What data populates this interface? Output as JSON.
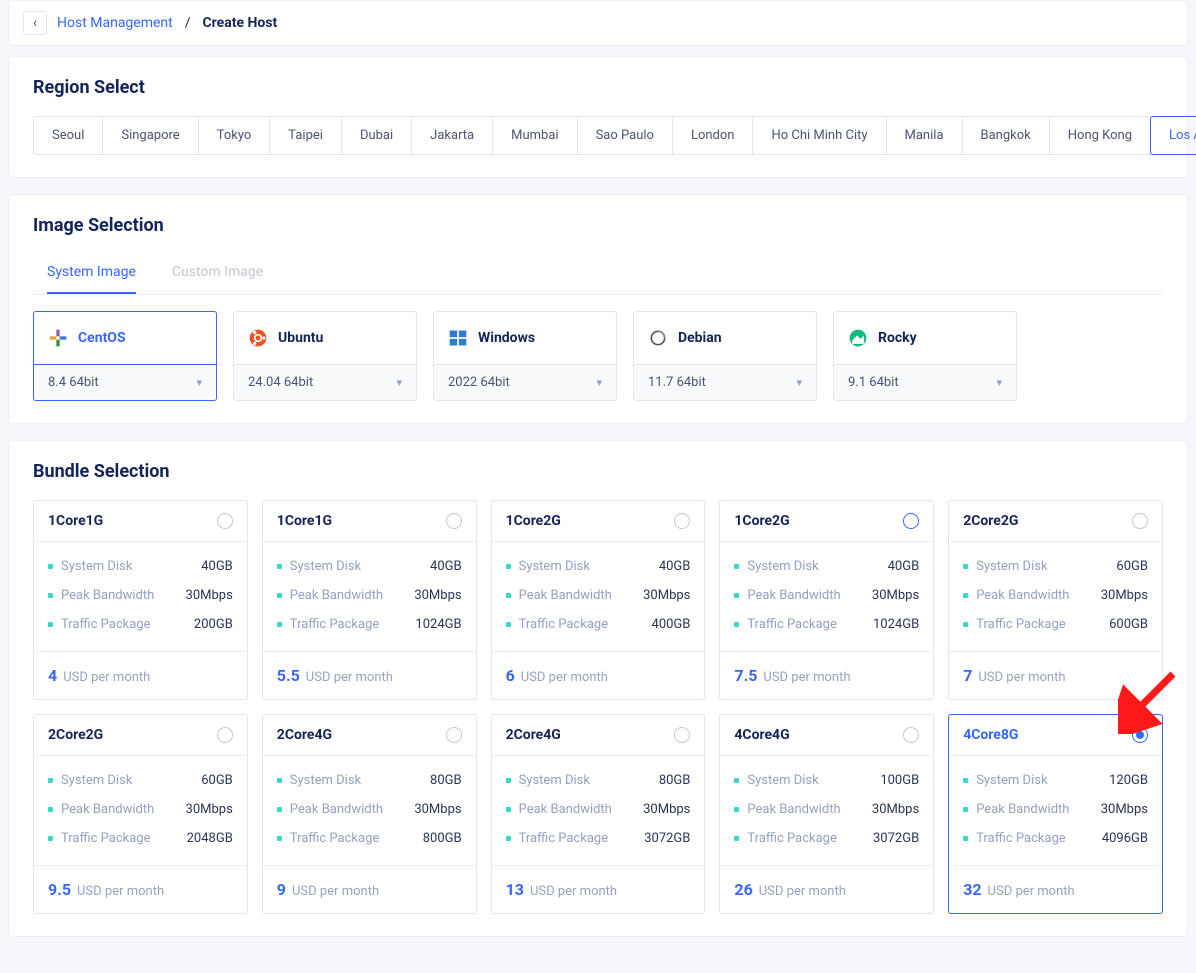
{
  "breadcrumb": {
    "back_icon": "‹",
    "link": "Host Management",
    "current": "Create Host"
  },
  "region": {
    "title": "Region Select",
    "items": [
      "Seoul",
      "Singapore",
      "Tokyo",
      "Taipei",
      "Dubai",
      "Jakarta",
      "Mumbai",
      "Sao Paulo",
      "London",
      "Ho Chi Minh City",
      "Manila",
      "Bangkok",
      "Hong Kong",
      "Los Angeles"
    ],
    "selected_index": 13
  },
  "image_section": {
    "title": "Image Selection",
    "tabs": [
      "System Image",
      "Custom Image"
    ],
    "active_tab": 0,
    "images": [
      {
        "name": "CentOS",
        "version": "8.4 64bit",
        "selected": true,
        "icon": "centos"
      },
      {
        "name": "Ubuntu",
        "version": "24.04 64bit",
        "selected": false,
        "icon": "ubuntu"
      },
      {
        "name": "Windows",
        "version": "2022 64bit",
        "selected": false,
        "icon": "windows"
      },
      {
        "name": "Debian",
        "version": "11.7 64bit",
        "selected": false,
        "icon": "debian"
      },
      {
        "name": "Rocky",
        "version": "9.1 64bit",
        "selected": false,
        "icon": "rocky"
      }
    ]
  },
  "bundle_section": {
    "title": "Bundle Selection",
    "spec_labels": {
      "disk": "System Disk",
      "bandwidth": "Peak Bandwidth",
      "traffic": "Traffic Package"
    },
    "price_suffix": "USD per month",
    "selected_index": 9,
    "ringed_index": 3,
    "bundles": [
      {
        "name": "1Core1G",
        "disk": "40GB",
        "bandwidth": "30Mbps",
        "traffic": "200GB",
        "price": "4"
      },
      {
        "name": "1Core1G",
        "disk": "40GB",
        "bandwidth": "30Mbps",
        "traffic": "1024GB",
        "price": "5.5"
      },
      {
        "name": "1Core2G",
        "disk": "40GB",
        "bandwidth": "30Mbps",
        "traffic": "400GB",
        "price": "6"
      },
      {
        "name": "1Core2G",
        "disk": "40GB",
        "bandwidth": "30Mbps",
        "traffic": "1024GB",
        "price": "7.5"
      },
      {
        "name": "2Core2G",
        "disk": "60GB",
        "bandwidth": "30Mbps",
        "traffic": "600GB",
        "price": "7"
      },
      {
        "name": "2Core2G",
        "disk": "60GB",
        "bandwidth": "30Mbps",
        "traffic": "2048GB",
        "price": "9.5"
      },
      {
        "name": "2Core4G",
        "disk": "80GB",
        "bandwidth": "30Mbps",
        "traffic": "800GB",
        "price": "9"
      },
      {
        "name": "2Core4G",
        "disk": "80GB",
        "bandwidth": "30Mbps",
        "traffic": "3072GB",
        "price": "13"
      },
      {
        "name": "4Core4G",
        "disk": "100GB",
        "bandwidth": "30Mbps",
        "traffic": "3072GB",
        "price": "26"
      },
      {
        "name": "4Core8G",
        "disk": "120GB",
        "bandwidth": "30Mbps",
        "traffic": "4096GB",
        "price": "32"
      }
    ]
  }
}
